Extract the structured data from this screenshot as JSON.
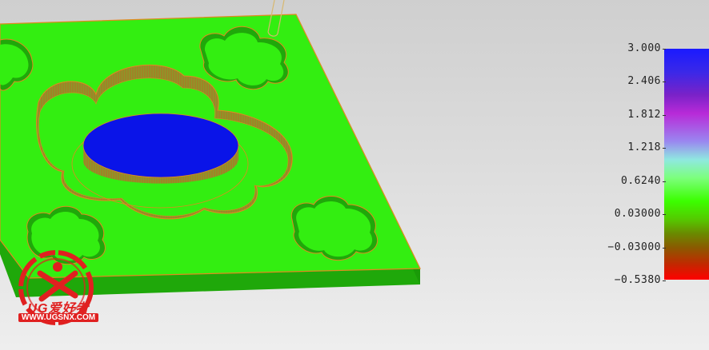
{
  "legend": {
    "labels": [
      "3.000",
      "2.406",
      "1.812",
      "1.218",
      "0.6240",
      "0.03000",
      "−0.03000",
      "−0.5380"
    ],
    "max": 3.0,
    "min": -0.538,
    "colors": {
      "top": "#1a1aff",
      "green": "#3bff00",
      "bottom": "#ff0000"
    }
  },
  "model": {
    "part_color": "#33ee11",
    "side_color": "#1fa80a",
    "boss_color": "#0a14e8",
    "wall_color": "#9a8a2a"
  },
  "watermark": {
    "brand": "UG爱好者",
    "url": "WWW.UGSNX.COM"
  }
}
